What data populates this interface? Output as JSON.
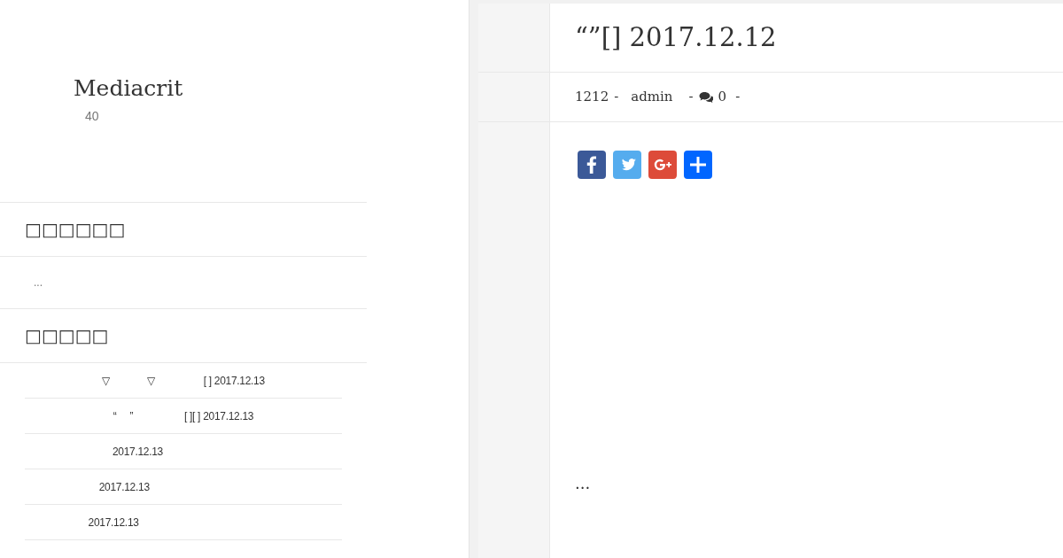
{
  "site": {
    "title": "Mediacrit",
    "tagline": "40"
  },
  "widgets": [
    {
      "title": "□□□□□□",
      "body": "..."
    },
    {
      "title": "□□□□□",
      "items": [
        "▽              ▽                  [ ] 2017.12.13",
        "“     ”                   [ ][ ] 2017.12.13",
        "2017.12.13                                  ",
        "2017.12.13                                            ",
        "2017.12.13                                                    "
      ]
    }
  ],
  "post": {
    "title": "“”[] 2017.12.12",
    "meta": {
      "date": "1212",
      "author": "admin",
      "comments": "0",
      "separators": [
        "-",
        "-",
        "-"
      ]
    },
    "share": [
      {
        "kind": "facebook",
        "color": "#3b5998"
      },
      {
        "kind": "twitter",
        "color": "#55acee"
      },
      {
        "kind": "google",
        "color": "#dd4b39"
      },
      {
        "kind": "more",
        "color": "#0166ff"
      }
    ],
    "excerpt": "..."
  }
}
